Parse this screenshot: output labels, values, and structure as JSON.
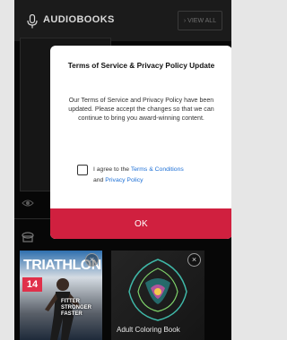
{
  "header": {
    "title": "AUDIOBOOKS",
    "view_all": "› VIEW ALL"
  },
  "modal": {
    "title": "Terms of Service & Privacy Policy Update",
    "body": "Our Terms of Service and Privacy Policy have been updated. Please accept the changes so that we can continue to bring you award-winning content.",
    "agree_prefix": "I agree to the",
    "terms_link": "Terms & Conditions",
    "and_text": "and",
    "privacy_link": "Privacy Policy",
    "ok_label": "OK",
    "checkbox_checked": false
  },
  "books": [
    {
      "cover_title": "TRIATHLON",
      "cover_number": "14",
      "cover_headline": "FITTER STRONGER FASTER"
    },
    {
      "cover_title": "Adult Coloring Book"
    }
  ],
  "colors": {
    "accent": "#d0203f",
    "link": "#1c6fd6",
    "background": "#070707"
  }
}
